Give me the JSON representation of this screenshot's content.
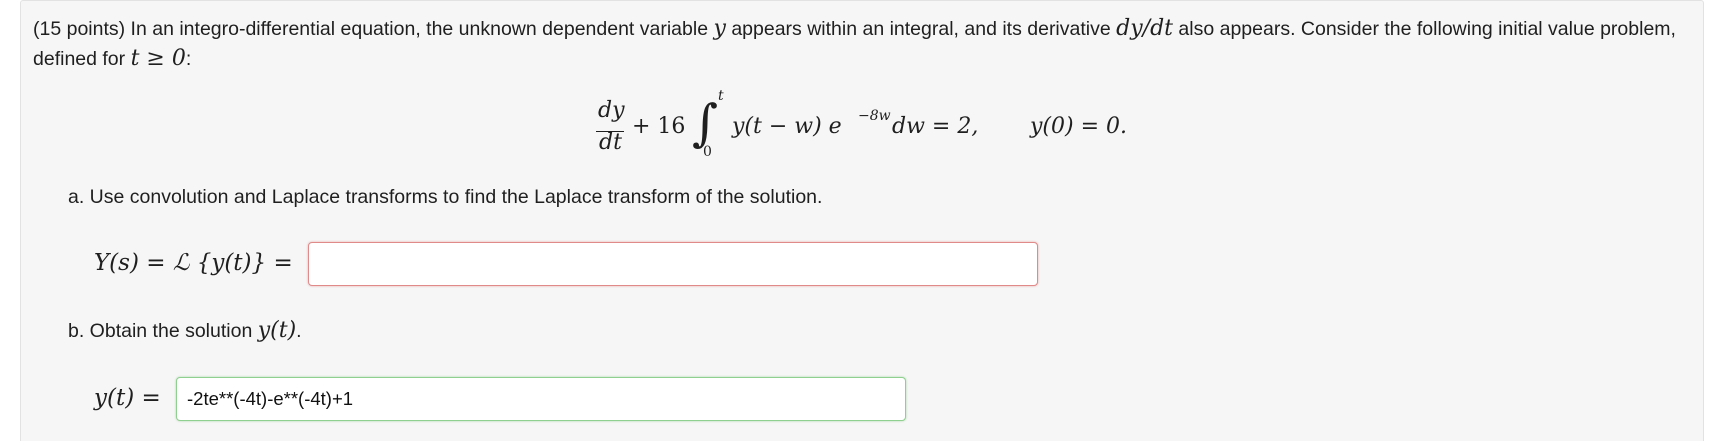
{
  "problem": {
    "points": "(15 points)",
    "intro_part1": " In an integro-differential equation, the unknown dependent variable ",
    "intro_var_y": "y",
    "intro_part2": " appears within an integral, and its derivative ",
    "intro_deriv": "dy/dt",
    "intro_part3": " also appears. Consider the following initial value problem, defined for ",
    "intro_condition": "t ≥ 0",
    "intro_end": ":"
  },
  "equation": {
    "frac_num": "dy",
    "frac_den": "dt",
    "plus_coef": "+ 16",
    "integral_sign": "∫",
    "upper_limit": "t",
    "lower_limit": "0",
    "integrand": "y(t − w) e",
    "exponent": "−8w",
    "differential": "dw = 2,",
    "initial_condition": "y(0) = 0."
  },
  "part_a": {
    "label": "a. Use convolution and Laplace transforms to find the Laplace transform of the solution.",
    "lhs": "Y(s) = ℒ {y(t)} =",
    "value": "",
    "status": "incorrect"
  },
  "part_b": {
    "label_prefix": "b. Obtain the solution ",
    "label_var": "y(t)",
    "label_suffix": ".",
    "lhs": "y(t) =",
    "value": "-2te**(-4t)-e**(-4t)+1",
    "status": "correct"
  },
  "colors": {
    "card_background": "#f6f6f6",
    "incorrect_border": "#e08a8a",
    "correct_border": "#8fcf8f"
  }
}
